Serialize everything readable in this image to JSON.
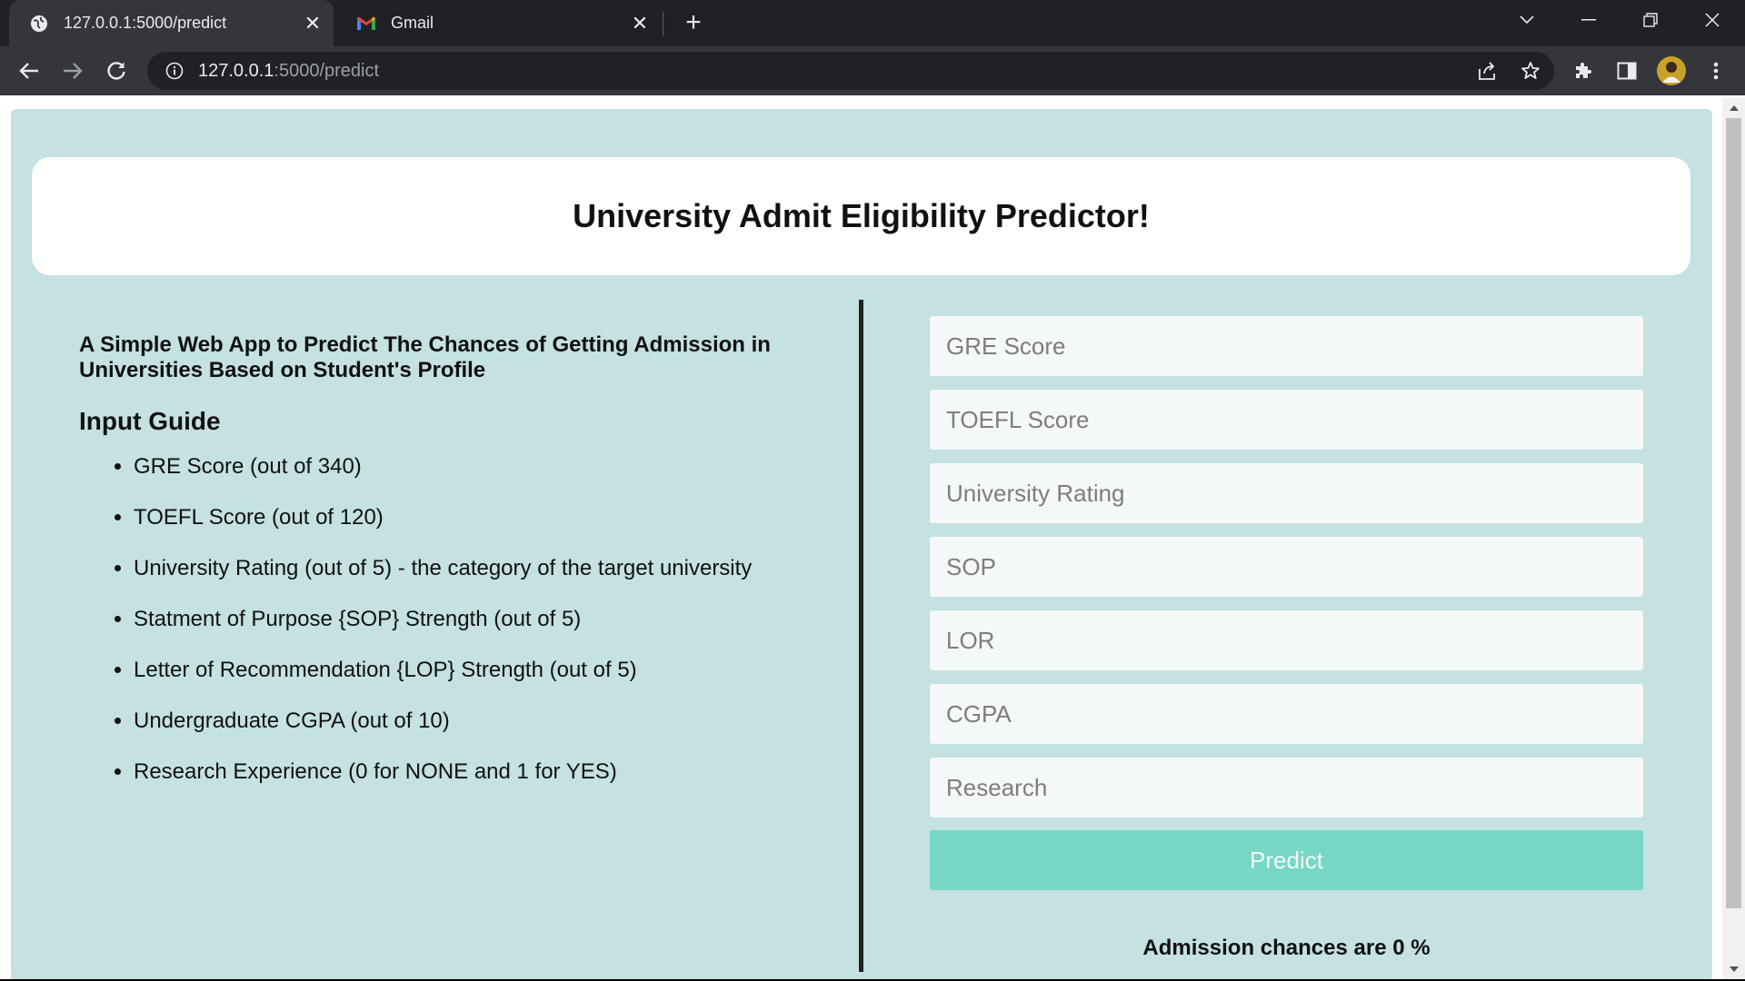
{
  "browser": {
    "tabs": [
      {
        "title": "127.0.0.1:5000/predict",
        "icon": "globe-icon",
        "active": true
      },
      {
        "title": "Gmail",
        "icon": "gmail-icon",
        "active": false
      }
    ],
    "url_host": "127.0.0.1",
    "url_path": ":5000/predict",
    "close_glyph": "✕",
    "newtab_glyph": "+"
  },
  "header": {
    "title": "University Admit Eligibility Predictor!"
  },
  "intro": {
    "subtitle": "A Simple Web App to Predict The Chances of Getting Admission in Universities Based on Student's Profile",
    "guide_title": "Input Guide",
    "guide_items": [
      "GRE Score (out of 340)",
      "TOEFL Score (out of 120)",
      "University Rating (out of 5) - the category of the target university",
      "Statment of Purpose {SOP} Strength (out of 5)",
      "Letter of Recommendation {LOP} Strength (out of 5)",
      "Undergraduate CGPA (out of 10)",
      "Research Experience (0 for NONE and 1 for YES)"
    ]
  },
  "form": {
    "fields": [
      {
        "placeholder": "GRE Score",
        "value": ""
      },
      {
        "placeholder": "TOEFL Score",
        "value": ""
      },
      {
        "placeholder": "University Rating",
        "value": ""
      },
      {
        "placeholder": "SOP",
        "value": ""
      },
      {
        "placeholder": "LOR",
        "value": ""
      },
      {
        "placeholder": "CGPA",
        "value": ""
      },
      {
        "placeholder": "Research",
        "value": ""
      }
    ],
    "submit_label": "Predict",
    "result_text": "Admission chances are 0 %"
  },
  "colors": {
    "panel_bg": "#c5e1e1",
    "button_bg": "#76d7c4",
    "chrome_dark": "#202124",
    "chrome_mid": "#35363a"
  }
}
